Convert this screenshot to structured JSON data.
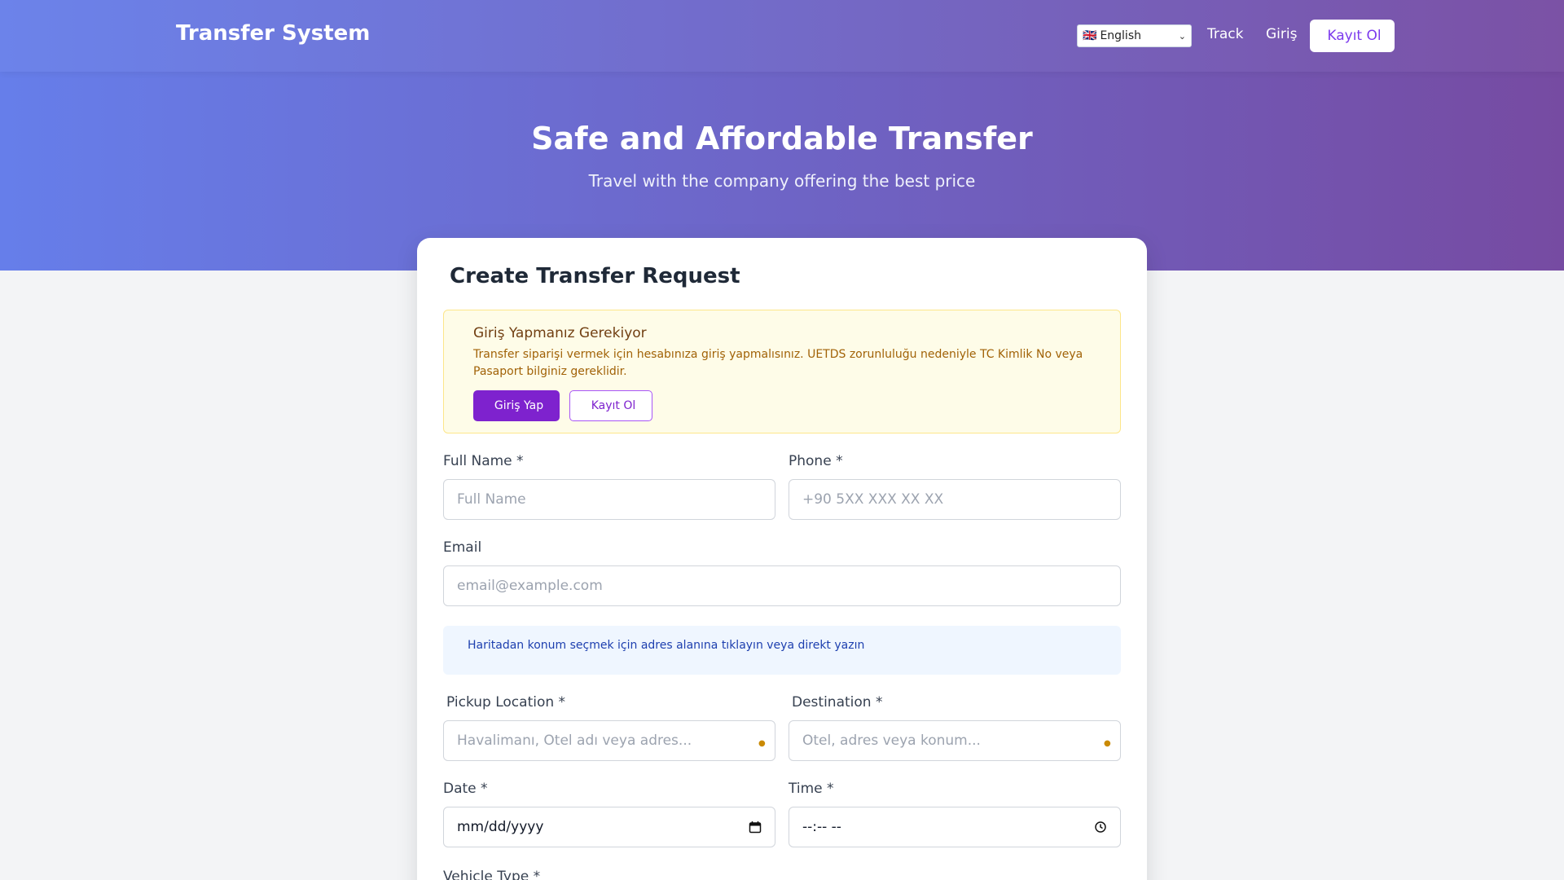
{
  "navbar": {
    "brand_icon": "",
    "brand": "Transfer System",
    "language": "English",
    "language_flag": "🇬🇧",
    "track_icon": "",
    "track": "Track",
    "login_icon": "",
    "login": "Giriş",
    "register_icon": "",
    "register": "Kayıt Ol"
  },
  "hero": {
    "title": "Safe and Affordable Transfer",
    "subtitle": "Travel with the company offering the best price"
  },
  "form": {
    "title_icon": "",
    "title": "Create Transfer Request",
    "alert": {
      "icon": "",
      "title": "Giriş Yapmanız Gerekiyor",
      "text": "Transfer siparişi vermek için hesabınıza giriş yapmalısınız. UETDS zorunluluğu nedeniyle TC Kimlik No veya Pasaport bilginiz gereklidir.",
      "login_icon": "",
      "login_button": "Giriş Yap",
      "register_icon": "",
      "register_button": "Kayıt Ol"
    },
    "full_name_label": "Full Name *",
    "full_name_placeholder": "Full Name",
    "phone_label": "Phone *",
    "phone_placeholder": "+90 5XX XXX XX XX",
    "email_label": "Email",
    "email_placeholder": "email@example.com",
    "info_icon": "",
    "info_text": "Haritadan konum seçmek için adres alanına tıklayın veya direkt yazın",
    "pickup_icon": "",
    "pickup_label": "Pickup Location *",
    "pickup_placeholder": "Havalimanı, Otel adı veya adres...",
    "pickup_icon_a": "",
    "pickup_icon_b": "",
    "destination_icon": "",
    "destination_label": "Destination *",
    "destination_placeholder": "Otel, adres veya konum...",
    "destination_icon_a": "",
    "date_label": "Date *",
    "date_value": "mm/dd/yyyy",
    "time_label": "Time *",
    "time_value": "--:-- --",
    "vehicle_label": "Vehicle Type *"
  },
  "colors": {
    "gradient_start": "#667eea",
    "gradient_end": "#764ba2",
    "accent": "#7e22ce"
  }
}
